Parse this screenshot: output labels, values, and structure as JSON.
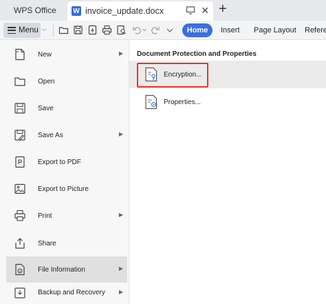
{
  "titlebar": {
    "app_tab_label": "WPS Office",
    "doc_tab_label": "invoice_update.docx",
    "doc_icon_letter": "W",
    "close_glyph": "✕",
    "add_glyph": "+"
  },
  "toolbar": {
    "menu_label": "Menu",
    "home_label": "Home",
    "insert_label": "Insert",
    "page_layout_label": "Page Layout",
    "references_label": "Referen"
  },
  "menu": {
    "items": [
      {
        "label": "New",
        "icon": "new-doc-icon",
        "has_submenu": true
      },
      {
        "label": "Open",
        "icon": "folder-icon",
        "has_submenu": false
      },
      {
        "label": "Save",
        "icon": "save-icon",
        "has_submenu": false
      },
      {
        "label": "Save As",
        "icon": "save-as-icon",
        "has_submenu": true
      },
      {
        "label": "Export to PDF",
        "icon": "pdf-icon",
        "has_submenu": false
      },
      {
        "label": "Export to Picture",
        "icon": "picture-icon",
        "has_submenu": false
      },
      {
        "label": "Print",
        "icon": "print-icon",
        "has_submenu": true
      },
      {
        "label": "Share",
        "icon": "share-icon",
        "has_submenu": false
      },
      {
        "label": "File Information",
        "icon": "info-icon",
        "has_submenu": true
      },
      {
        "label": "Backup and Recovery",
        "icon": "backup-icon",
        "has_submenu": true
      }
    ]
  },
  "file_info_panel": {
    "section_title": "Document Protection and Properties",
    "encryption_label": "Encryption...",
    "properties_label": "Properties..."
  },
  "colors": {
    "accent": "#3d6fdf",
    "highlight_border": "#e8322d",
    "doc_icon": "#2f6fe0"
  }
}
